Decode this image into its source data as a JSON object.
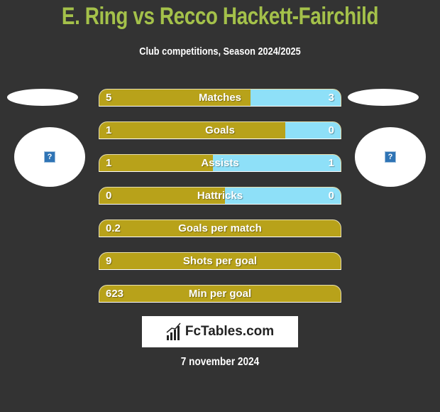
{
  "header": {
    "title": "E. Ring vs Recco Hackett-Fairchild",
    "subtitle": "Club competitions, Season 2024/2025"
  },
  "colors": {
    "left_bar": "#b8a21a",
    "right_bar": "#8ee0f8",
    "title": "#a4c14a",
    "background": "#333333"
  },
  "players": {
    "left": {
      "avatar_icon": "question-icon"
    },
    "right": {
      "avatar_icon": "question-icon"
    }
  },
  "stats": [
    {
      "label": "Matches",
      "left": "5",
      "right": "3",
      "right_share": 0.375
    },
    {
      "label": "Goals",
      "left": "1",
      "right": "0",
      "right_share": 0.23
    },
    {
      "label": "Assists",
      "left": "1",
      "right": "1",
      "right_share": 0.53
    },
    {
      "label": "Hattricks",
      "left": "0",
      "right": "0",
      "right_share": 0.48
    },
    {
      "label": "Goals per match",
      "left": "0.2",
      "right": "",
      "right_share": 0
    },
    {
      "label": "Shots per goal",
      "left": "9",
      "right": "",
      "right_share": 0
    },
    {
      "label": "Min per goal",
      "left": "623",
      "right": "",
      "right_share": 0
    }
  ],
  "footer": {
    "logo_text": "FcTables.com",
    "date": "7 november 2024"
  }
}
